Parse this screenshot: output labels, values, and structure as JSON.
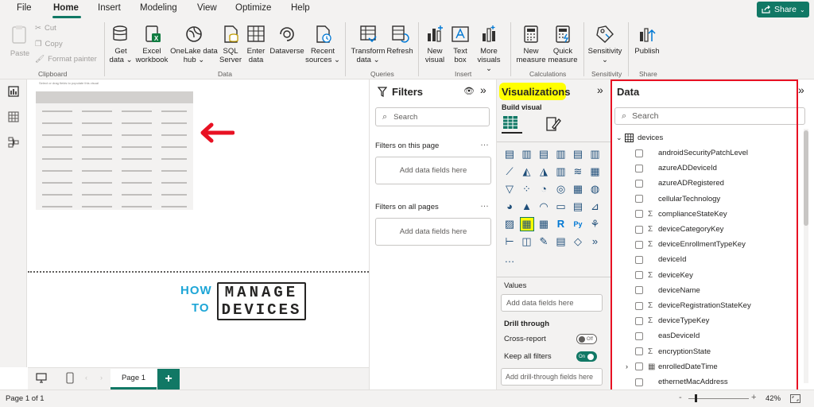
{
  "menu": {
    "tabs": [
      "File",
      "Home",
      "Insert",
      "Modeling",
      "View",
      "Optimize",
      "Help"
    ],
    "share": "Share"
  },
  "ribbon": {
    "clipboard": {
      "paste": "Paste",
      "cut": "Cut",
      "copy": "Copy",
      "format_painter": "Format painter",
      "label": "Clipboard"
    },
    "data": {
      "get_data": [
        "Get",
        "data ⌄"
      ],
      "excel": [
        "Excel",
        "workbook"
      ],
      "onelake": [
        "OneLake data",
        "hub ⌄"
      ],
      "sql": [
        "SQL",
        "Server"
      ],
      "enter": [
        "Enter",
        "data"
      ],
      "dataverse": [
        "Dataverse"
      ],
      "recent": [
        "Recent",
        "sources ⌄"
      ],
      "label": "Data"
    },
    "queries": {
      "transform": [
        "Transform",
        "data ⌄"
      ],
      "refresh": [
        "Refresh"
      ],
      "label": "Queries"
    },
    "insert": {
      "new_visual": [
        "New",
        "visual"
      ],
      "text_box": [
        "Text",
        "box"
      ],
      "more_visuals": [
        "More",
        "visuals ⌄"
      ],
      "label": "Insert"
    },
    "calculations": {
      "new_measure": [
        "New",
        "measure"
      ],
      "quick_measure": [
        "Quick",
        "measure"
      ],
      "label": "Calculations"
    },
    "sensitivity": {
      "sensitivity": [
        "Sensitivity",
        "⌄"
      ],
      "label": "Sensitivity"
    },
    "share": {
      "publish": [
        "Publish"
      ],
      "label": "Share"
    }
  },
  "canvas": {
    "hint": "Select or drag fields to populate this visual",
    "logo": {
      "how": "HOW",
      "to": "TO",
      "manage": "MANAGE",
      "devices": "DEVICES"
    }
  },
  "pagebar": {
    "page_tab": "Page 1",
    "add": "+"
  },
  "status": {
    "page_info": "Page 1 of 1",
    "zoom": "42%"
  },
  "filters": {
    "title": "Filters",
    "search_placeholder": "Search",
    "on_page": "Filters on this page",
    "on_all": "Filters on all pages",
    "add_fields": "Add data fields here"
  },
  "viz": {
    "title": "Visualizations",
    "build_visual": "Build visual",
    "values": "Values",
    "add_fields": "Add data fields here",
    "drill_through": "Drill through",
    "cross_report": "Cross-report",
    "cross_report_state": "Off",
    "keep_filters": "Keep all filters",
    "keep_filters_state": "On",
    "add_drill": "Add drill-through fields here",
    "highlight_color": "#ffff00",
    "accent": "#117865"
  },
  "data": {
    "title": "Data",
    "search_placeholder": "Search",
    "table": "devices",
    "fields": [
      {
        "name": "androidSecurityPatchLevel",
        "sigma": false
      },
      {
        "name": "azureADDeviceId",
        "sigma": false
      },
      {
        "name": "azureADRegistered",
        "sigma": false
      },
      {
        "name": "cellularTechnology",
        "sigma": false
      },
      {
        "name": "complianceStateKey",
        "sigma": true
      },
      {
        "name": "deviceCategoryKey",
        "sigma": true
      },
      {
        "name": "deviceEnrollmentTypeKey",
        "sigma": true
      },
      {
        "name": "deviceId",
        "sigma": false
      },
      {
        "name": "deviceKey",
        "sigma": true
      },
      {
        "name": "deviceName",
        "sigma": false
      },
      {
        "name": "deviceRegistrationStateKey",
        "sigma": true
      },
      {
        "name": "deviceTypeKey",
        "sigma": true
      },
      {
        "name": "easDeviceId",
        "sigma": false
      },
      {
        "name": "encryptionState",
        "sigma": true
      },
      {
        "name": "enrolledDateTime",
        "sigma": false
      },
      {
        "name": "ethernetMacAddress",
        "sigma": false
      }
    ],
    "highlight_border": "#e81123"
  }
}
